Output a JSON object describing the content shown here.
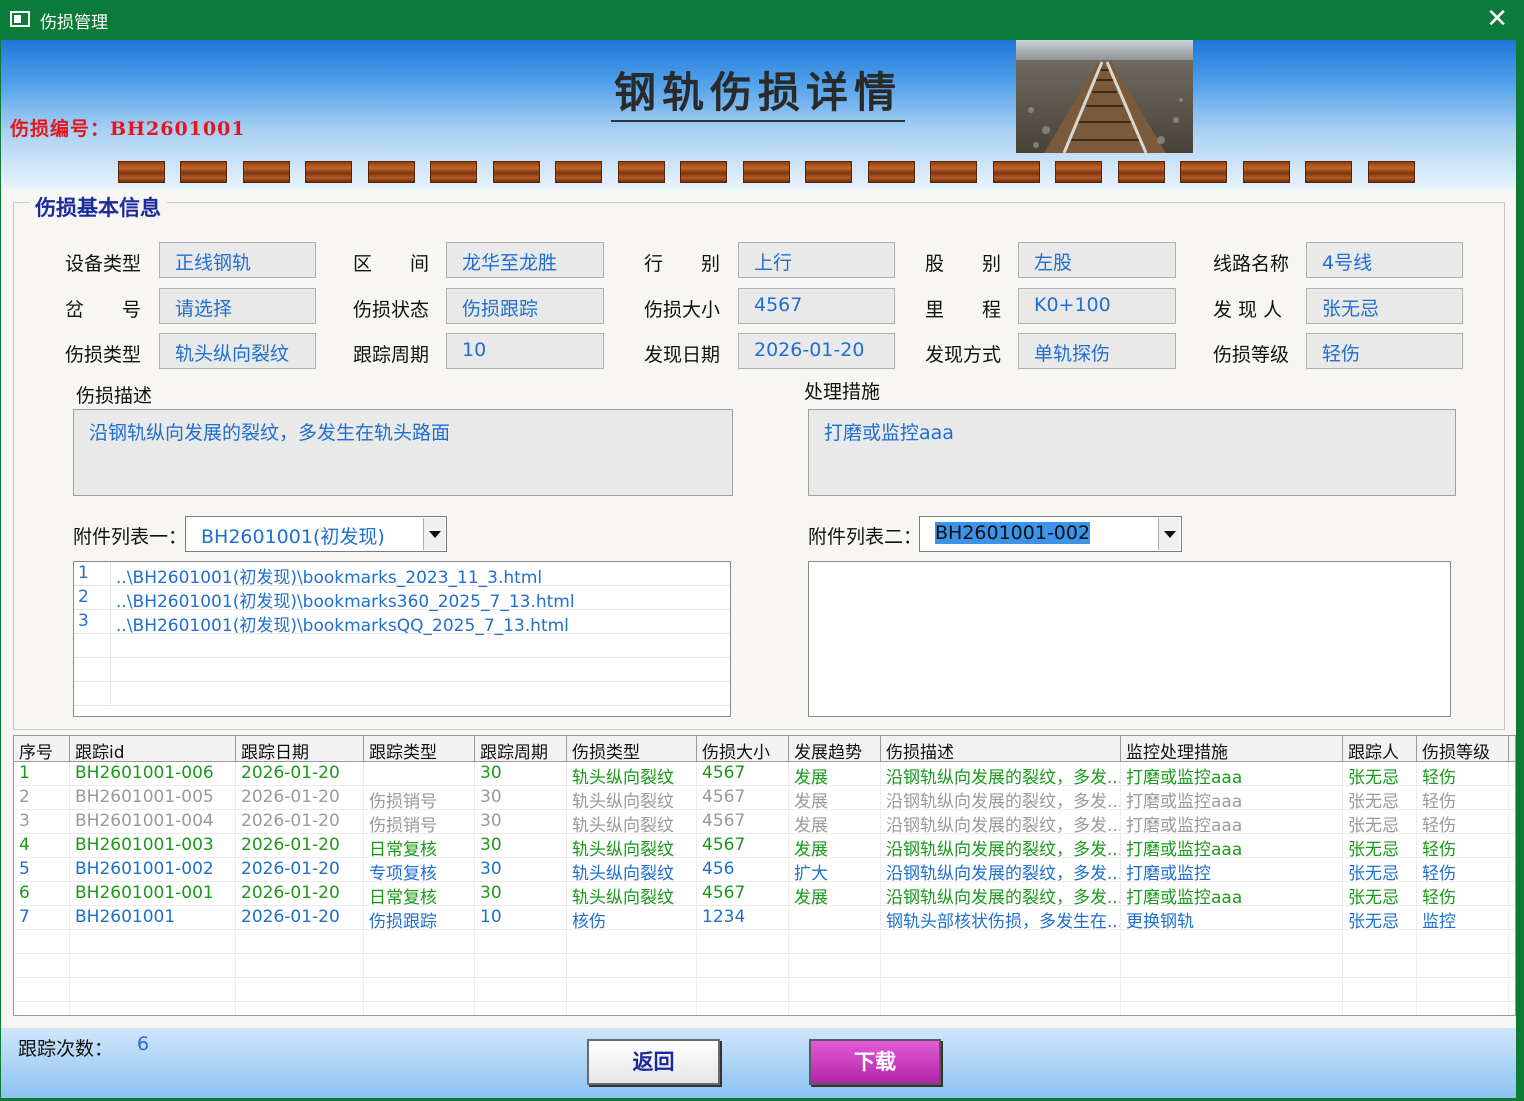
{
  "window": {
    "title": "伤损管理",
    "close_glyph": "✕"
  },
  "header": {
    "code_label": "伤损编号：BH2601001",
    "main_title": "钢轨伤损详情"
  },
  "basic_info": {
    "title": "伤损基本信息",
    "fields": [
      {
        "label": "设备类型",
        "value": "正线钢轨"
      },
      {
        "label": "区　　间",
        "value": "龙华至龙胜"
      },
      {
        "label": "行　　别",
        "value": "上行"
      },
      {
        "label": "股　　别",
        "value": "左股"
      },
      {
        "label": "线路名称",
        "value": "4号线"
      },
      {
        "label": "岔　　号",
        "value": "请选择"
      },
      {
        "label": "伤损状态",
        "value": "伤损跟踪"
      },
      {
        "label": "伤损大小",
        "value": "4567"
      },
      {
        "label": "里　　程",
        "value": "K0+100"
      },
      {
        "label": "发 现 人",
        "value": "张无忌"
      },
      {
        "label": "伤损类型",
        "value": "轨头纵向裂纹"
      },
      {
        "label": "跟踪周期",
        "value": "10"
      },
      {
        "label": "发现日期",
        "value": "2026-01-20"
      },
      {
        "label": "发现方式",
        "value": "单轨探伤"
      },
      {
        "label": "伤损等级",
        "value": "轻伤"
      }
    ],
    "description": {
      "label": "伤损描述",
      "value": "沿钢轨纵向发展的裂纹，多发生在轨头路面"
    },
    "measures": {
      "label": "处理措施",
      "value": "打磨或监控aaa"
    }
  },
  "attachments": {
    "list1_label": "附件列表一：",
    "list1_selected": "BH2601001(初发现)",
    "list1_items": [
      {
        "n": "1",
        "path": "..\\BH2601001(初发现)\\bookmarks_2023_11_3.html"
      },
      {
        "n": "2",
        "path": "..\\BH2601001(初发现)\\bookmarks360_2025_7_13.html"
      },
      {
        "n": "3",
        "path": "..\\BH2601001(初发现)\\bookmarksQQ_2025_7_13.html"
      }
    ],
    "list2_label": "附件列表二：",
    "list2_selected": "BH2601001-002"
  },
  "table": {
    "columns": [
      "序号",
      "跟踪id",
      "跟踪日期",
      "跟踪类型",
      "跟踪周期",
      "伤损类型",
      "伤损大小",
      "发展趋势",
      "伤损描述",
      "监控处理措施",
      "跟踪人",
      "伤损等级"
    ],
    "rows": [
      {
        "style": "green",
        "cells": [
          "1",
          "BH2601001-006",
          "2026-01-20",
          "",
          "30",
          "轨头纵向裂纹",
          "4567",
          "发展",
          "沿钢轨纵向发展的裂纹，多发...",
          "打磨或监控aaa",
          "张无忌",
          "轻伤"
        ]
      },
      {
        "style": "gray",
        "cells": [
          "2",
          "BH2601001-005",
          "2026-01-20",
          "伤损销号",
          "30",
          "轨头纵向裂纹",
          "4567",
          "发展",
          "沿钢轨纵向发展的裂纹，多发...",
          "打磨或监控aaa",
          "张无忌",
          "轻伤"
        ]
      },
      {
        "style": "gray",
        "cells": [
          "3",
          "BH2601001-004",
          "2026-01-20",
          "伤损销号",
          "30",
          "轨头纵向裂纹",
          "4567",
          "发展",
          "沿钢轨纵向发展的裂纹，多发...",
          "打磨或监控aaa",
          "张无忌",
          "轻伤"
        ]
      },
      {
        "style": "green",
        "cells": [
          "4",
          "BH2601001-003",
          "2026-01-20",
          "日常复核",
          "30",
          "轨头纵向裂纹",
          "4567",
          "发展",
          "沿钢轨纵向发展的裂纹，多发...",
          "打磨或监控aaa",
          "张无忌",
          "轻伤"
        ]
      },
      {
        "style": "blue",
        "cells": [
          "5",
          "BH2601001-002",
          "2026-01-20",
          "专项复核",
          "30",
          "轨头纵向裂纹",
          "456",
          "扩大",
          "沿钢轨纵向发展的裂纹，多发...",
          "打磨或监控",
          "张无忌",
          "轻伤"
        ]
      },
      {
        "style": "green",
        "cells": [
          "6",
          "BH2601001-001",
          "2026-01-20",
          "日常复核",
          "30",
          "轨头纵向裂纹",
          "4567",
          "发展",
          "沿钢轨纵向发展的裂纹，多发...",
          "打磨或监控aaa",
          "张无忌",
          "轻伤"
        ]
      },
      {
        "style": "blue",
        "cells": [
          "7",
          "BH2601001",
          "2026-01-20",
          "伤损跟踪",
          "10",
          "核伤",
          "1234",
          "",
          "钢轨头部核状伤损，多发生在...",
          "更换钢轨",
          "张无忌",
          "监控"
        ]
      }
    ]
  },
  "footer": {
    "count_label": "跟踪次数：",
    "count_value": "6",
    "back_button": "返回",
    "download_button": "下载"
  },
  "colors": {
    "titlebar": "#0b7b3a",
    "code_label": "#e8141c",
    "value_text": "#1f6fd0",
    "group_title": "#1a2a9c",
    "download_button": "#c33bb8"
  },
  "icons": {
    "window": "window-app-icon",
    "close": "close-icon",
    "dropdown": "chevron-down-icon",
    "railway": "railway-track-image"
  }
}
